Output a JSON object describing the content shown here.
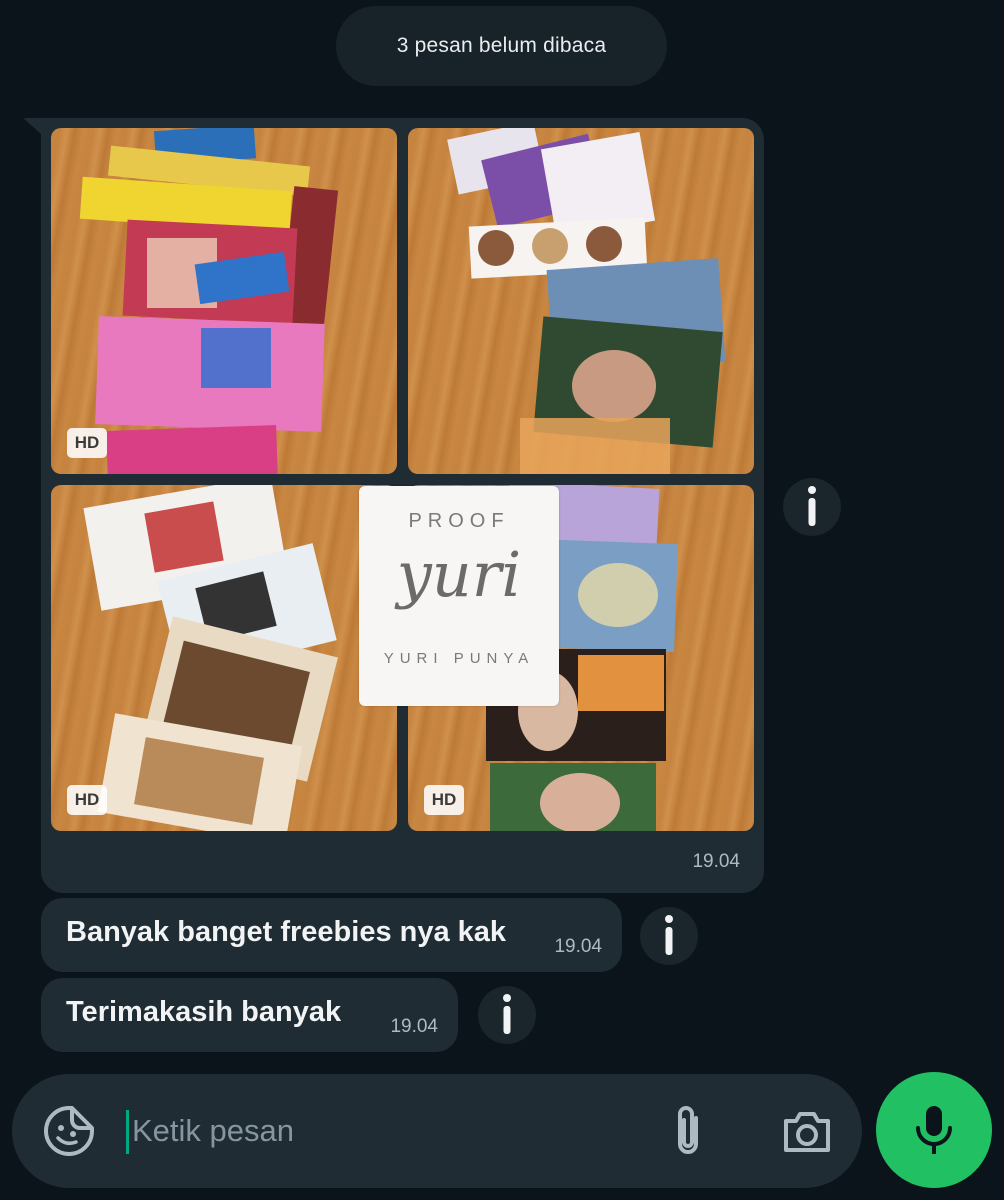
{
  "unread_banner": "3 pesan belum dibaca",
  "album": {
    "hd_badge": "HD",
    "time": "19.04",
    "watermark": {
      "top": "PROOF",
      "middle": "yuri",
      "bottom": "YURI PUNYA"
    }
  },
  "messages": [
    {
      "text": "Banyak banget freebies nya kak",
      "time": "19.04"
    },
    {
      "text": "Terimakasih banyak",
      "time": "19.04"
    }
  ],
  "composer": {
    "placeholder": "Ketik pesan"
  },
  "icons": [
    "info-icon",
    "sticker-icon",
    "attach-icon",
    "camera-icon",
    "mic-icon"
  ],
  "colors": {
    "background": "#0b141a",
    "bubble": "#1f2c33",
    "accent": "#21c063",
    "meta_text": "#aebac1"
  }
}
